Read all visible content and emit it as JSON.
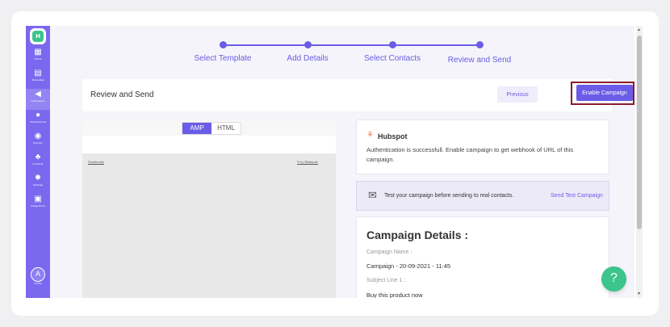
{
  "sidebar": {
    "logo": "H",
    "items": [
      {
        "label": "Home",
        "icon": "grid-icon"
      },
      {
        "label": "Templates",
        "icon": "template-icon"
      },
      {
        "label": "Campaigns",
        "icon": "megaphone-icon"
      },
      {
        "label": "Transactional",
        "icon": "bolt-icon"
      },
      {
        "label": "Domain",
        "icon": "globe-icon"
      },
      {
        "label": "Contacts",
        "icon": "contacts-icon"
      },
      {
        "label": "Settings",
        "icon": "gear-icon"
      },
      {
        "label": "Integrations",
        "icon": "integrations-icon"
      }
    ],
    "active_item": "Campaigns",
    "profile_initial": "A",
    "profile_label": "Profile"
  },
  "stepper": {
    "steps": [
      "Select Template",
      "Add Details",
      "Select Contacts",
      "Review and Send"
    ],
    "accent": "#6b5ce7"
  },
  "review": {
    "title": "Review and Send",
    "previous_label": "Previous",
    "enable_label": "Enable Campaign"
  },
  "preview": {
    "tabs": [
      "AMP",
      "HTML"
    ],
    "selected_tab": "AMP",
    "unsubscribe": "Unsubscribe",
    "byline": "by Mailmodo"
  },
  "hubspot": {
    "title": "Hubspot",
    "message": "Authentication is successfull. Enable campaign to get webhook of URL of this campaign."
  },
  "test": {
    "message": "Test your campaign before sending to real contacts.",
    "link": "Send Test Campaign"
  },
  "details": {
    "title": "Campaign Details :",
    "name_label": "Campaign Name :",
    "name_value": "Campaign - 20-09-2021 - 11:45",
    "subject_label": "Subject Line 1 :",
    "subject_value": "Buy this product now"
  },
  "colors": {
    "sidebar": "#7b68ee",
    "accent": "#6b5ce7",
    "help": "#3bc48b",
    "highlight_border": "#8b1c2c"
  }
}
